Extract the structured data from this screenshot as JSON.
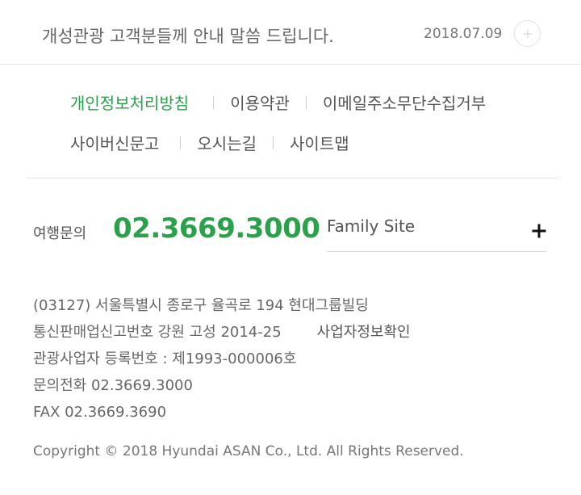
{
  "notice": {
    "text": "개성관광 고객분들께 안내 말씀 드립니다.",
    "date": "2018.07.09",
    "more_icon": "plus-icon"
  },
  "links": {
    "row1": [
      "개인정보처리방침",
      "이용약관",
      "이메일주소무단수집거부"
    ],
    "row2": [
      "사이버신문고",
      "오시는길",
      "사이트맵"
    ]
  },
  "contact": {
    "label": "여행문의",
    "phone": "02.3669.3000"
  },
  "family_site": {
    "label": "Family Site",
    "icon": "plus-icon"
  },
  "info": {
    "address": "(03127) 서울특별시 종로구 율곡로 194 현대그룹빌딩",
    "telecom_reg": "통신판매업신고번호 강원 고성 2014-25",
    "business_info_link": "사업자정보확인",
    "tourism_reg": "관광사업자 등록번호 : 제1993-000006호",
    "phone": "문의전화 02.3669.3000",
    "fax": "FAX 02.3669.3690"
  },
  "copyright": "Copyright © 2018 Hyundai ASAN Co., Ltd. All Rights Reserved.",
  "colors": {
    "accent": "#2ba14b",
    "text": "#555555",
    "divider": "#e3e3e3"
  }
}
